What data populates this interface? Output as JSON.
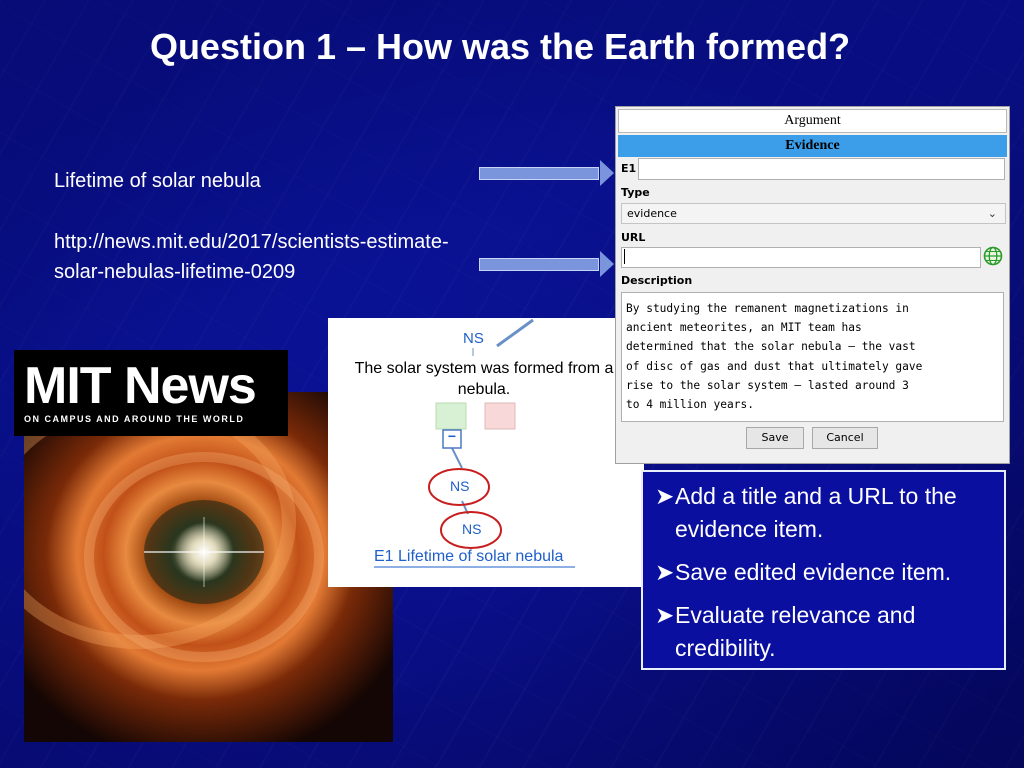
{
  "slide": {
    "title": "Question 1 – How was the Earth formed?",
    "left_label": "Lifetime of solar nebula",
    "url_line1": "http://news.mit.edu/2017/scientists-estimate-",
    "url_line2": "solar-nebulas-lifetime-0209"
  },
  "mit_logo": {
    "main": "MIT News",
    "tagline": "ON CAMPUS AND AROUND THE WORLD"
  },
  "map_snippet": {
    "top_node": "NS",
    "claim": [
      "The solar system was formed from a",
      "nebula."
    ],
    "collapse_symbol": "−",
    "node1": "NS",
    "node2": "NS",
    "evidence_link": "E1 Lifetime of solar nebula"
  },
  "form": {
    "tab_argument": "Argument",
    "tab_evidence": "Evidence",
    "e1_label": "E1",
    "e1_value": "",
    "type_label": "Type",
    "type_value": "evidence",
    "url_label": "URL",
    "url_value": "",
    "description_label": "Description",
    "description_lines": [
      "By studying the remanent magnetizations in",
      "ancient meteorites, an MIT team has",
      "determined that the solar nebula — the vast",
      "of disc of gas and dust that ultimately gave",
      "rise to the solar system — lasted around 3",
      "to 4 million years."
    ],
    "save_label": "Save",
    "cancel_label": "Cancel"
  },
  "instructions": [
    "Add a title and a URL to the evidence item.",
    "Save edited evidence item.",
    "Evaluate relevance and credibility."
  ],
  "icons": {
    "bullet": "arrowhead-bullet-icon",
    "globe": "globe-icon",
    "chevron": "chevron-down-icon"
  },
  "colors": {
    "background": "#0a1296",
    "evidence_tab": "#3c9ee8",
    "node_circle": "#c81e1e",
    "node_text": "#1e5fc8",
    "pro_box": "#d8f0d4",
    "con_box": "#f8d8d8"
  }
}
